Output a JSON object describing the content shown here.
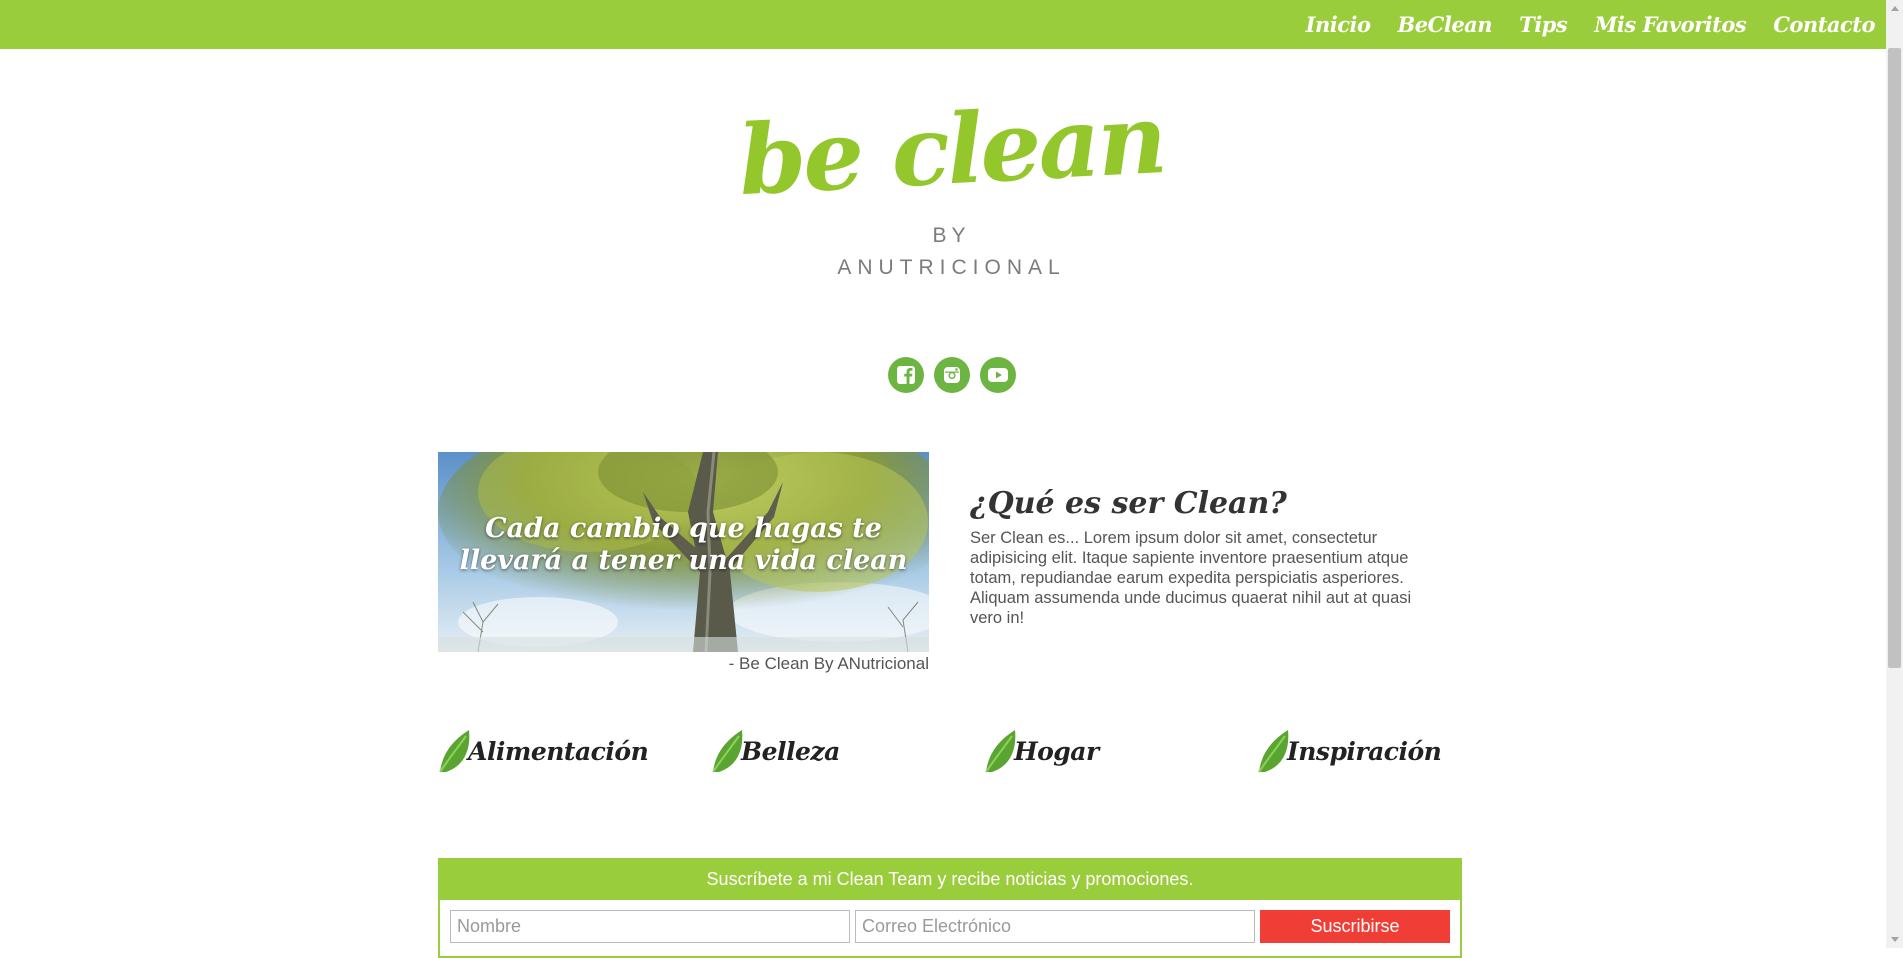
{
  "nav": {
    "items": [
      "Inicio",
      "BeClean",
      "Tips",
      "Mis Favoritos",
      "Contacto"
    ]
  },
  "header": {
    "logo": "be clean",
    "by": "BY",
    "brand": "ANUTRICIONAL"
  },
  "social": [
    "facebook-icon",
    "instagram-icon",
    "youtube-icon"
  ],
  "hero": {
    "quote": "Cada cambio que hagas te llevará a tener una vida clean",
    "credit": "- Be Clean By ANutricional"
  },
  "about": {
    "title": "¿Qué es ser Clean?",
    "text": "Ser Clean es... Lorem ipsum dolor sit amet, consectetur adipisicing elit. Itaque sapiente inventore praesentium atque totam, repudiandae earum expedita perspiciatis asperiores. Aliquam assumenda unde ducimus quaerat nihil aut at quasi vero in!"
  },
  "categories": [
    "Alimentación",
    "Belleza",
    "Hogar",
    "Inspiración"
  ],
  "subscribe": {
    "heading": "Suscríbete a mi Clean Team y recibe noticias y promociones.",
    "name_placeholder": "Nombre",
    "email_placeholder": "Correo Electrónico",
    "button": "Suscribirse"
  },
  "colors": {
    "accent_green": "#9acd3c",
    "icon_green": "#6db542",
    "button_red": "#f03e36"
  }
}
